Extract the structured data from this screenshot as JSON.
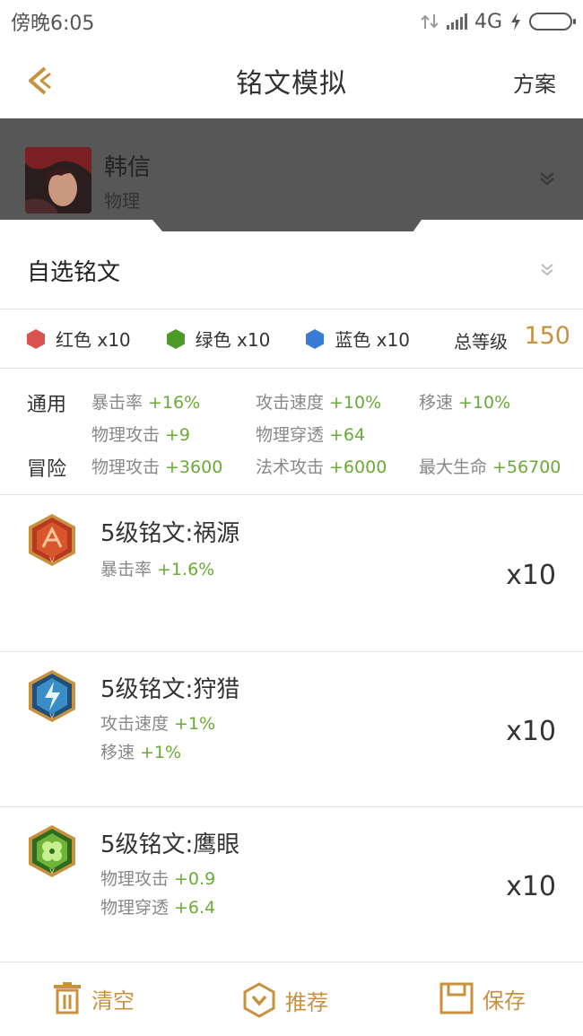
{
  "status_bar": {
    "time": "傍晚6:05",
    "network": "4G",
    "battery_color": "#2eb82e"
  },
  "nav": {
    "title": "铭文模拟",
    "right_label": "方案"
  },
  "hero": {
    "name": "韩信",
    "type": "物理"
  },
  "custom": {
    "label": "自选铭文"
  },
  "colors": {
    "red": {
      "label": "红色 x10",
      "color": "#d9534f"
    },
    "green": {
      "label": "绿色 x10",
      "color": "#4c9a2a"
    },
    "blue": {
      "label": "蓝色 x10",
      "color": "#3a7bd5"
    },
    "total_label": "总等级",
    "total_value": "150"
  },
  "attributes": {
    "general_label": "通用",
    "adventure_label": "冒险",
    "general": [
      {
        "name": "暴击率",
        "value": "+16%"
      },
      {
        "name": "攻击速度",
        "value": "+10%"
      },
      {
        "name": "移速",
        "value": "+10%"
      },
      {
        "name": "物理攻击",
        "value": "+9"
      },
      {
        "name": "物理穿透",
        "value": "+64"
      }
    ],
    "adventure": [
      {
        "name": "物理攻击",
        "value": "+3600"
      },
      {
        "name": "法术攻击",
        "value": "+6000"
      },
      {
        "name": "最大生命",
        "value": "+56700"
      }
    ]
  },
  "runes": [
    {
      "name": "5级铭文:祸源",
      "icon": "red-rune-icon",
      "stats": [
        {
          "name": "暴击率",
          "value": "+1.6%"
        }
      ],
      "count": "x10"
    },
    {
      "name": "5级铭文:狩猎",
      "icon": "blue-rune-icon",
      "stats": [
        {
          "name": "攻击速度",
          "value": "+1%"
        },
        {
          "name": "移速",
          "value": "+1%"
        }
      ],
      "count": "x10"
    },
    {
      "name": "5级铭文:鹰眼",
      "icon": "green-rune-icon",
      "stats": [
        {
          "name": "物理攻击",
          "value": "+0.9"
        },
        {
          "name": "物理穿透",
          "value": "+6.4"
        }
      ],
      "count": "x10"
    }
  ],
  "bottom": {
    "clear_label": "清空",
    "recommend_label": "推荐",
    "save_label": "保存",
    "accent_color": "#c8913e"
  }
}
